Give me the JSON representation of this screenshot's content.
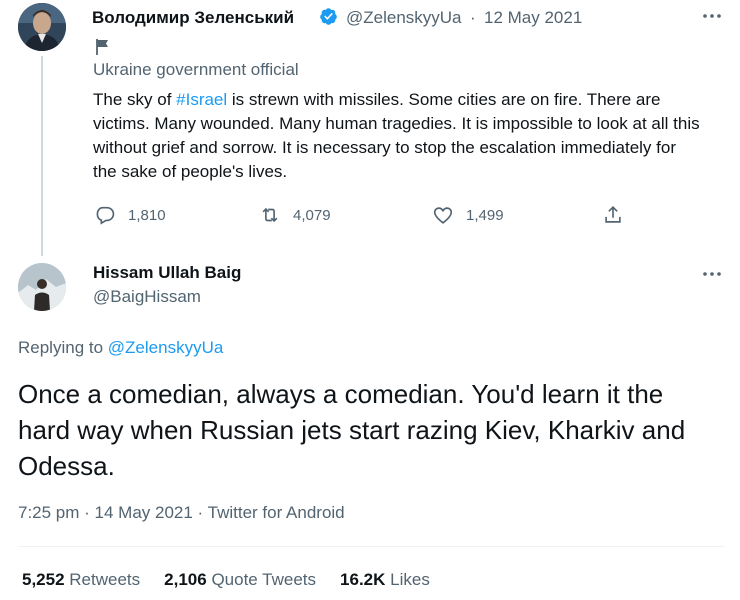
{
  "parent_tweet": {
    "author_name": "Володимир Зеленський",
    "handle": "@ZelenskyyUa",
    "separator": "·",
    "date": "12 May 2021",
    "account_label": "Ukraine government official",
    "text_before": "The sky of ",
    "hashtag": "#Israel",
    "text_after": " is strewn with missiles. Some cities are on fire. There are victims. Many wounded. Many human tragedies. It is impossible to look at all this without grief and sorrow. It is necessary to stop the escalation immediately for the sake of people's lives.",
    "replies": "1,810",
    "retweets": "4,079",
    "likes": "1,499"
  },
  "reply_tweet": {
    "author_name": "Hissam Ullah Baig",
    "handle": "@BaigHissam",
    "replying_prefix": "Replying to ",
    "replying_to": "@ZelenskyyUa",
    "text": "Once a comedian, always a comedian. You'd learn it the hard way when Russian jets start razing Kiev, Kharkiv and Odessa.",
    "meta": "7:25 pm · 14 May 2021 · Twitter for Android",
    "retweets_count": "5,252",
    "retweets_label": "Retweets",
    "quote_count": "2,106",
    "quote_label": "Quote Tweets",
    "likes_count": "16.2K",
    "likes_label": "Likes"
  },
  "colors": {
    "accent": "#1d9bf0",
    "secondary_text": "#536471",
    "primary_text": "#0f1419"
  }
}
